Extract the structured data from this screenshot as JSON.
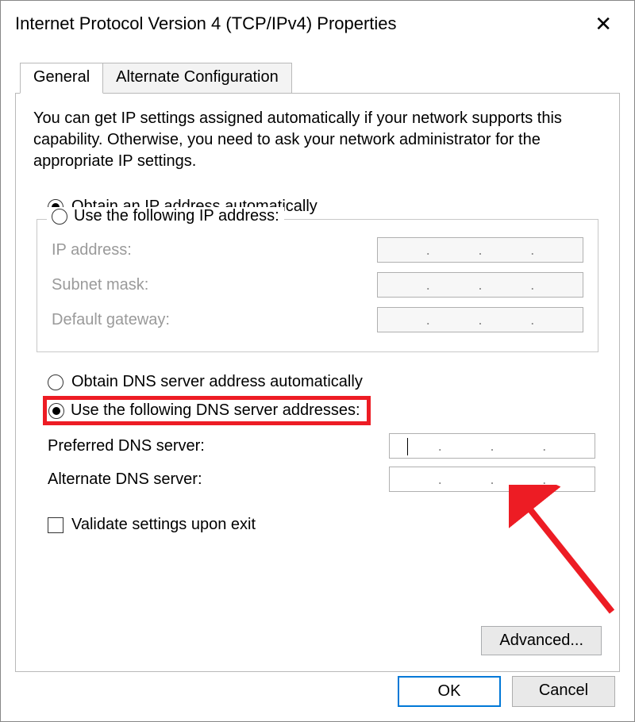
{
  "window": {
    "title": "Internet Protocol Version 4 (TCP/IPv4) Properties"
  },
  "tabs": {
    "general": "General",
    "alternate": "Alternate Configuration"
  },
  "description": "You can get IP settings assigned automatically if your network supports this capability. Otherwise, you need to ask your network administrator for the appropriate IP settings.",
  "ip": {
    "auto_label": "Obtain an IP address automatically",
    "manual_label": "Use the following IP address:",
    "ip_address_label": "IP address:",
    "subnet_label": "Subnet mask:",
    "gateway_label": "Default gateway:"
  },
  "dns": {
    "auto_label": "Obtain DNS server address automatically",
    "manual_label": "Use the following DNS server addresses:",
    "preferred_label": "Preferred DNS server:",
    "alternate_label": "Alternate DNS server:"
  },
  "validate_label": "Validate settings upon exit",
  "buttons": {
    "advanced": "Advanced...",
    "ok": "OK",
    "cancel": "Cancel"
  }
}
